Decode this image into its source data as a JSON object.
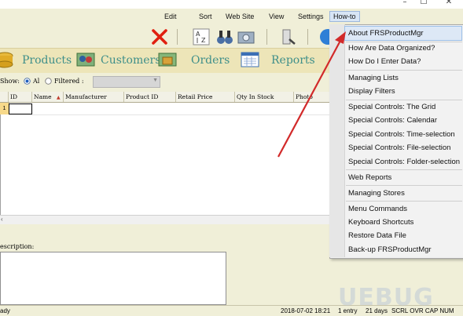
{
  "window": {
    "minimize": "–",
    "maximize": "☐",
    "close": "✕"
  },
  "menubar": {
    "items": [
      "Edit",
      "Sort",
      "Web Site",
      "View",
      "Settings",
      "How-to"
    ]
  },
  "nav": {
    "tabs": [
      "Products",
      "Customers",
      "Orders",
      "Reports"
    ]
  },
  "filter": {
    "show_label": "Show:",
    "all_label": "Al",
    "filtered_label": "Filtered :",
    "selected": "All"
  },
  "grid": {
    "columns": [
      "ID",
      "Name",
      "Manufacturer",
      "Product ID",
      "Retail Price",
      "Qty In Stock",
      "Photo"
    ],
    "sort_indicator": "▲",
    "row_marker": "1"
  },
  "description": {
    "label": "escription:"
  },
  "status": {
    "left": "ady",
    "datetime": "2018-07-02 18:21",
    "entries": "1 entry",
    "days": "21 days",
    "indicators": "SCRL OVR CAP NUM"
  },
  "howto_menu": {
    "items": [
      "About FRSProductMgr",
      "How Are Data Organized?",
      "How Do I Enter Data?",
      "Managing Lists",
      "Display Filters",
      "Special Controls: The Grid",
      "Special Controls: Calendar",
      "Special Controls: Time-selection",
      "Special Controls: File-selection",
      "Special Controls: Folder-selection",
      "Web Reports",
      "Managing Stores",
      "Menu Commands",
      "Keyboard Shortcuts",
      "Restore Data File",
      "Back-up FRSProductMgr"
    ]
  },
  "watermark": {
    "text": "UEBUG"
  },
  "colors": {
    "nav_text": "#3f8f8a",
    "arrow": "#d22a2a",
    "highlight": "#dde8f6",
    "background": "#f0efd8"
  },
  "icons": {
    "toolbar": [
      "delete-x-icon",
      "sort-az-icon",
      "binoculars-icon",
      "camera-icon",
      "settings-wrench-icon",
      "help-globe-icon"
    ],
    "nav": [
      "products-icon",
      "customers-icon",
      "orders-icon",
      "reports-icon"
    ]
  }
}
